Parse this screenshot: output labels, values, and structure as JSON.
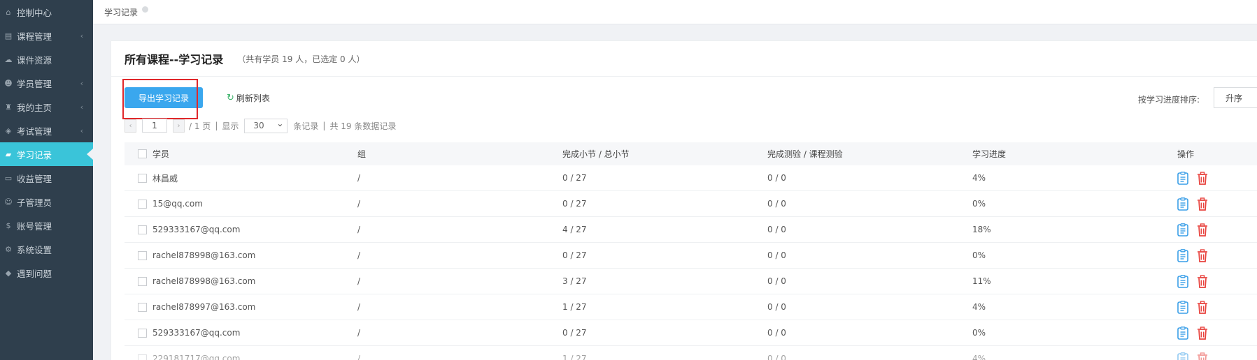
{
  "sidebar": {
    "items": [
      {
        "label": "控制中心",
        "icon": "home-icon",
        "glyph": "⌂",
        "chevron": false,
        "active": false
      },
      {
        "label": "课程管理",
        "icon": "book-icon",
        "glyph": "▤",
        "chevron": true,
        "active": false
      },
      {
        "label": "课件资源",
        "icon": "cloud-icon",
        "glyph": "☁",
        "chevron": false,
        "active": false
      },
      {
        "label": "学员管理",
        "icon": "users-icon",
        "glyph": "☻",
        "chevron": true,
        "active": false
      },
      {
        "label": "我的主页",
        "icon": "graduation-cap-icon",
        "glyph": "♜",
        "chevron": true,
        "active": false
      },
      {
        "label": "考试管理",
        "icon": "tag-icon",
        "glyph": "◈",
        "chevron": true,
        "active": false
      },
      {
        "label": "学习记录",
        "icon": "notebook-icon",
        "glyph": "▰",
        "chevron": false,
        "active": true
      },
      {
        "label": "收益管理",
        "icon": "credit-card-icon",
        "glyph": "▭",
        "chevron": false,
        "active": false
      },
      {
        "label": "子管理员",
        "icon": "user-icon",
        "glyph": "☺",
        "chevron": false,
        "active": false
      },
      {
        "label": "账号管理",
        "icon": "dollar-icon",
        "glyph": "$",
        "chevron": false,
        "active": false
      },
      {
        "label": "系统设置",
        "icon": "gear-icon",
        "glyph": "⚙",
        "chevron": false,
        "active": false
      },
      {
        "label": "遇到问题",
        "icon": "pill-icon",
        "glyph": "◆",
        "chevron": false,
        "active": false
      }
    ],
    "chevron_glyph": "‹"
  },
  "breadcrumb": {
    "current": "学习记录"
  },
  "panel": {
    "title": "所有课程--学习记录",
    "subtitle": "（共有学员 19 人，已选定 0 人）"
  },
  "toolbar": {
    "export_label": "导出学习记录",
    "refresh_label": "刷新列表",
    "refresh_icon": "↻",
    "sort_label": "按学习进度排序:",
    "sort_value": "升序"
  },
  "pager": {
    "prev": "‹",
    "next": "›",
    "page_value": "1",
    "total_pages": "/ 1 页",
    "show": "显示",
    "per_page": "30",
    "records_suffix": "条记录",
    "total_records": "共 19 条数据记录",
    "sep": "|"
  },
  "table": {
    "headers": {
      "student": "学员",
      "group": "组",
      "sections": "完成小节 / 总小节",
      "quiz": "完成测验 / 课程测验",
      "progress": "学习进度",
      "ops": "操作"
    },
    "rows": [
      {
        "student": "林昌威",
        "group": "/",
        "sections": "0 / 27",
        "quiz": "0 / 0",
        "progress": "4%"
      },
      {
        "student": "15@qq.com",
        "group": "/",
        "sections": "0 / 27",
        "quiz": "0 / 0",
        "progress": "0%"
      },
      {
        "student": "529333167@qq.com",
        "group": "/",
        "sections": "4 / 27",
        "quiz": "0 / 0",
        "progress": "18%"
      },
      {
        "student": "rachel878998@163.com",
        "group": "/",
        "sections": "0 / 27",
        "quiz": "0 / 0",
        "progress": "0%"
      },
      {
        "student": "rachel878998@163.com",
        "group": "/",
        "sections": "3 / 27",
        "quiz": "0 / 0",
        "progress": "11%"
      },
      {
        "student": "rachel878997@163.com",
        "group": "/",
        "sections": "1 / 27",
        "quiz": "0 / 0",
        "progress": "4%"
      },
      {
        "student": "529333167@qq.com",
        "group": "/",
        "sections": "0 / 27",
        "quiz": "0 / 0",
        "progress": "0%"
      },
      {
        "student": "229181717@qq.com",
        "group": "/",
        "sections": "1 / 27",
        "quiz": "0 / 0",
        "progress": "4%"
      }
    ]
  },
  "colors": {
    "sidebar_bg": "#2f3f4d",
    "active_nav": "#3ac4d9",
    "export_button": "#3aa7ee",
    "highlight": "#e0282b",
    "detail_icon": "#3a9fe8",
    "delete_icon": "#e8433e",
    "refresh_icon": "#3bb36a"
  }
}
